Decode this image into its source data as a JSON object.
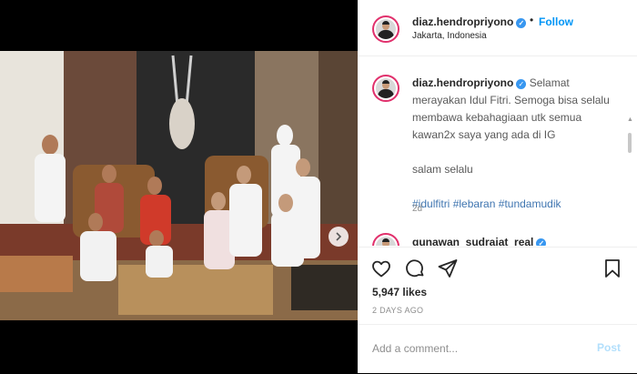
{
  "header": {
    "username": "diaz.hendropriyono",
    "separator": "•",
    "follow_label": "Follow",
    "location": "Jakarta, Indonesia",
    "more_icon": "more-horizontal-icon"
  },
  "caption": {
    "username": "diaz.hendropriyono",
    "text": "Selamat merayakan Idul Fitri. Semoga bisa selalu membawa kebahagiaan utk semua kawan2x saya yang ada di IG",
    "closing": "salam selalu",
    "hashtags": [
      "#idulfitri",
      "#lebaran",
      "#tundamudik"
    ],
    "time": "2d"
  },
  "comments": [
    {
      "username": "gunawan_sudrajat_real"
    }
  ],
  "actions": {
    "likes": "5,947 likes",
    "posted_ago": "2 DAYS AGO"
  },
  "add_comment": {
    "placeholder": "Add a comment...",
    "post_label": "Post"
  },
  "carousel": {
    "slide_count": 4,
    "active_index": 0
  },
  "colors": {
    "accent": "#0095f6",
    "hashtag": "#3f75b0",
    "verified": "#3897f0"
  }
}
